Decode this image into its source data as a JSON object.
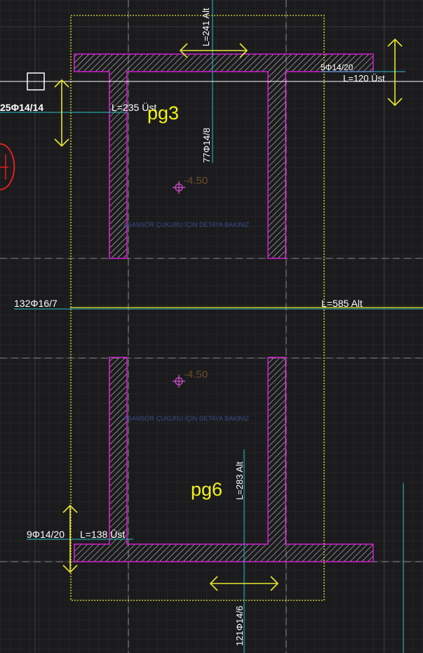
{
  "colors": {
    "background": "#1b1b1d",
    "grid_minor": "#2b2b2e",
    "grid_major": "#3a3a3e",
    "wall_outline": "#d21fd2",
    "hatch": "#c8c8c8",
    "rebar_line": "#27c0c8",
    "boundary": "#e8e830",
    "page_label": "#f2f216",
    "arrows": "#e8e830",
    "text": "#ffffff",
    "elevation_text": "#6a4c2a",
    "note_text": "#3a4c8c",
    "marker": "#d050d0",
    "red_arc": "#e02020"
  },
  "labels": {
    "pg3": "pg3",
    "pg6": "pg6"
  },
  "rebar": {
    "top_vertical_length": "L=241 Alt",
    "top_vertical_count": "77Φ14/8",
    "right_short_count": "5Φ14/20",
    "right_short_length": "L=120 Üst",
    "left_top_count": "25Φ14/14",
    "left_top_length": "L=235 Üst",
    "middle_count": "132Φ16/7",
    "middle_length": "L=585 Alt",
    "bottom_vertical_length": "L=283 Alt",
    "bottom_vertical_count": "121Φ14/6",
    "bottom_left_count": "9Φ14/20",
    "bottom_left_length": "L=138 Üst"
  },
  "elevations": {
    "upper": "-4.50",
    "lower": "-4.50"
  },
  "notes": {
    "upper_pit": "ASANSÖR ÇUKURU İÇİN DETAYA BAKINIZ",
    "lower_pit": "ASANSÖR ÇUKURU İÇİN DETAYA BAKINIZ"
  },
  "icons": {
    "snap_box": "square-cursor-icon",
    "elevation_marker": "crosshair-marker-icon",
    "dimension_arrows": "double-arrow-icon"
  }
}
